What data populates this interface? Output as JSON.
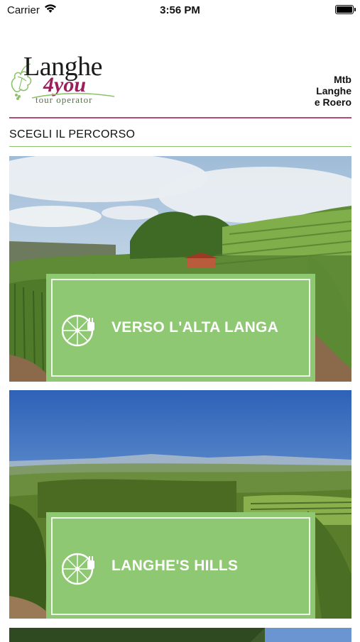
{
  "status_bar": {
    "carrier": "Carrier",
    "time": "3:56 PM"
  },
  "header": {
    "logo": {
      "line1": "Langhe",
      "line2": "4you",
      "line3": "tour operator"
    },
    "title_lines": [
      "Mtb",
      "Langhe",
      "e Roero"
    ]
  },
  "section": {
    "title": "SCEGLI IL PERCORSO"
  },
  "routes": [
    {
      "label": "VERSO L'ALTA LANGA",
      "icon": "bike-wheel-icon"
    },
    {
      "label": "LANGHE'S HILLS",
      "icon": "bike-wheel-icon"
    }
  ],
  "colors": {
    "accent_green": "#8fc872",
    "brand_magenta": "#9b1e5a"
  }
}
